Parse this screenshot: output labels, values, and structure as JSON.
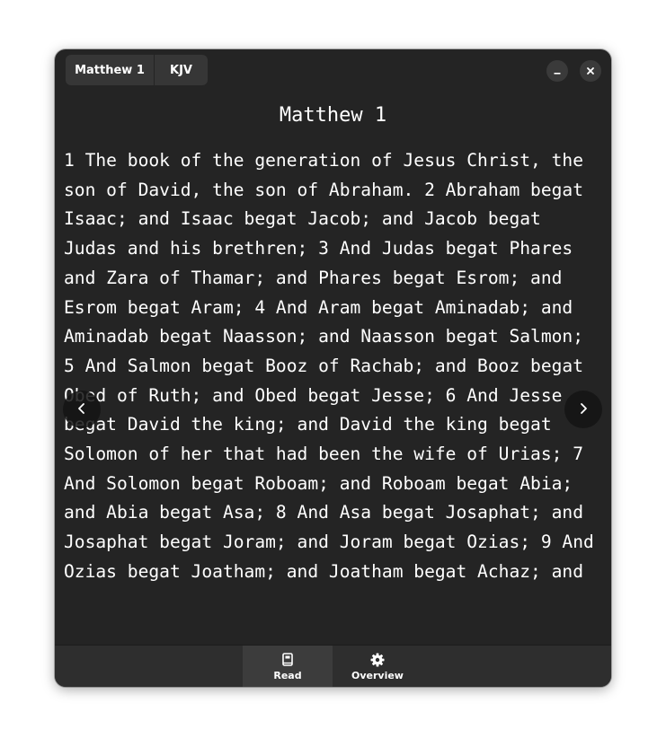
{
  "header": {
    "book_button_label": "Matthew 1",
    "translation_button_label": "KJV"
  },
  "window_controls": {
    "minimize_icon": "minimize-icon",
    "close_icon": "close-icon"
  },
  "reader": {
    "chapter_title": "Matthew 1",
    "text": "1 The book of the generation of Jesus Christ, the son of David, the son of Abraham. 2 Abraham begat Isaac; and Isaac begat Jacob; and Jacob begat Judas and his brethren; 3 And Judas begat Phares and Zara of Thamar; and Phares begat Esrom; and Esrom begat Aram; 4 And Aram begat Aminadab; and Aminadab begat Naasson; and Naasson begat Salmon; 5 And Salmon begat Booz of Rachab; and Booz begat Obed of Ruth; and Obed begat Jesse; 6 And Jesse begat David the king; and David the king begat Solomon of her that had been the wife of Urias; 7 And Solomon begat Roboam; and Roboam begat Abia; and Abia begat Asa; 8 And Asa begat Josaphat; and Josaphat begat Joram; and Joram begat Ozias; 9 And Ozias begat Joatham; and Joatham begat Achaz; and",
    "prev_icon": "chevron-left-icon",
    "next_icon": "chevron-right-icon"
  },
  "view_switcher": {
    "items": [
      {
        "label": "Read",
        "icon": "book-icon",
        "active": true
      },
      {
        "label": "Overview",
        "icon": "gear-icon",
        "active": false
      }
    ]
  },
  "colors": {
    "window_bg": "#242424",
    "button_bg": "#363636",
    "switcher_bg": "#2e2e2e",
    "switcher_active_bg": "#3c3c3c",
    "text": "#ffffff"
  }
}
